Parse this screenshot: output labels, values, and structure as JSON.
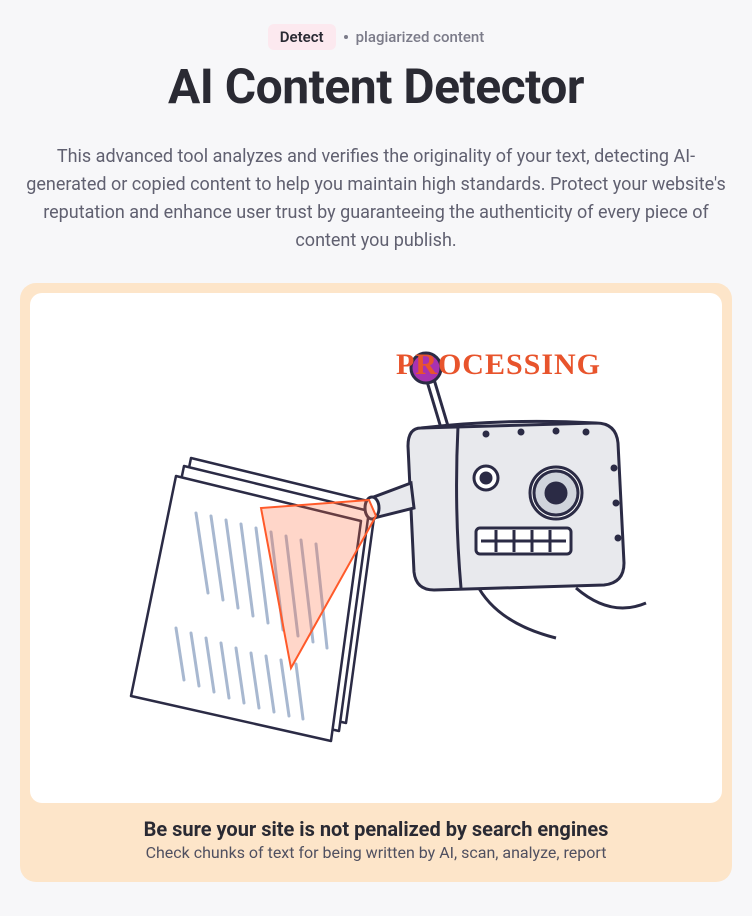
{
  "header": {
    "pill_left": "Detect",
    "pill_right": "plagiarized content",
    "title": "AI Content Detector",
    "description": "This advanced tool analyzes and verifies the originality of your text, detecting AI-generated or copied content to help you maintain high standards. Protect your website's reputation and enhance user trust by guaranteeing the authenticity of every piece of content you publish."
  },
  "illustration": {
    "processing_label": "PROCESSING"
  },
  "card": {
    "caption_title": "Be sure your site is not penalized by search engines",
    "caption_sub": "Check chunks of text for being written by AI, scan, analyze, report"
  }
}
